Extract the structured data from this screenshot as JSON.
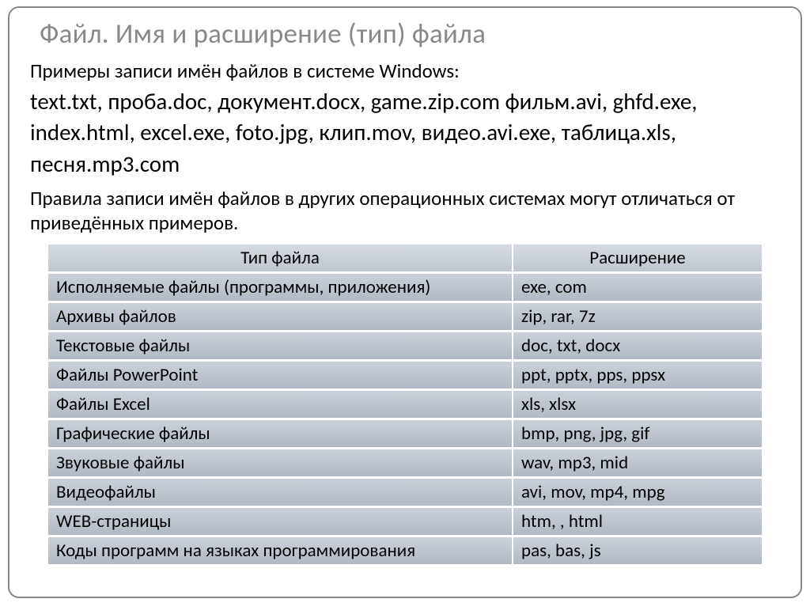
{
  "title": "Файл. Имя и расширение (тип) файла",
  "intro": "Примеры записи имён файлов в системе Windows:",
  "examples": "text.txt, проба.doc, документ.docx, game.zip.com фильм.avi, ghfd.exe, index.html, excel.exe, foto.jpg, клип.mov, видео.avi.exe, таблица.xls, песня.mp3.com",
  "note": "Правила записи имён файлов в других операционных системах могут отличаться от приведённых примеров.",
  "table": {
    "headers": {
      "type": "Тип файла",
      "ext": "Расширение"
    },
    "rows": [
      {
        "type": "Исполняемые файлы (программы, приложения)",
        "ext": "exe, com"
      },
      {
        "type": "Архивы файлов",
        "ext": "zip, rar, 7z"
      },
      {
        "type": "Текстовые файлы",
        "ext": "doc, txt, docx"
      },
      {
        "type": "Файлы PowerPoint",
        "ext": "ppt, pptx, pps, ppsx"
      },
      {
        "type": "Файлы Excel",
        "ext": "xls, xlsx"
      },
      {
        "type": "Графические файлы",
        "ext": "bmp, png, jpg, gif"
      },
      {
        "type": "Звуковые файлы",
        "ext": "wav, mp3, mid"
      },
      {
        "type": "Видеофайлы",
        "ext": "avi, mov, mp4, mpg"
      },
      {
        "type": "WEB-страницы",
        "ext": "htm, , html"
      },
      {
        "type": "Коды программ на языках программирования",
        "ext": "pas, bas, js"
      }
    ]
  }
}
